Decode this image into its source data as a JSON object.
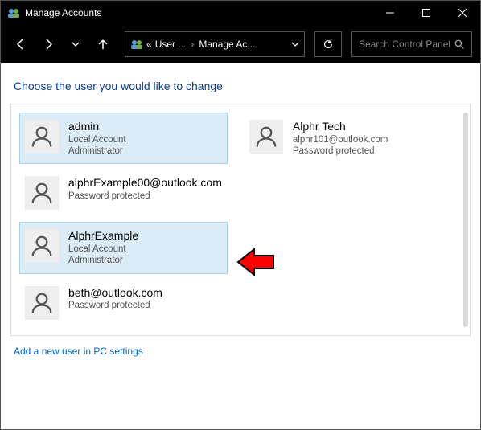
{
  "window": {
    "title": "Manage Accounts"
  },
  "breadcrumb": {
    "level1_prefix": "«",
    "level1": "User ...",
    "level2": "Manage Ac..."
  },
  "search": {
    "placeholder": "Search Control Panel"
  },
  "heading": "Choose the user you would like to change",
  "users_left": [
    {
      "name": "admin",
      "line1": "Local Account",
      "line2": "Administrator",
      "selected": true
    },
    {
      "name": "alphrExample00@outlook.com",
      "line1": "Password protected",
      "line2": "",
      "selected": false
    },
    {
      "name": "AlphrExample",
      "line1": "Local Account",
      "line2": "Administrator",
      "selected": true
    },
    {
      "name": "beth@outlook.com",
      "line1": "Password protected",
      "line2": "",
      "selected": false
    }
  ],
  "users_right": [
    {
      "name": "Alphr Tech",
      "line1": "alphr101@outlook.com",
      "line2": "Password protected",
      "selected": false
    }
  ],
  "addlink": "Add a new user in PC settings"
}
